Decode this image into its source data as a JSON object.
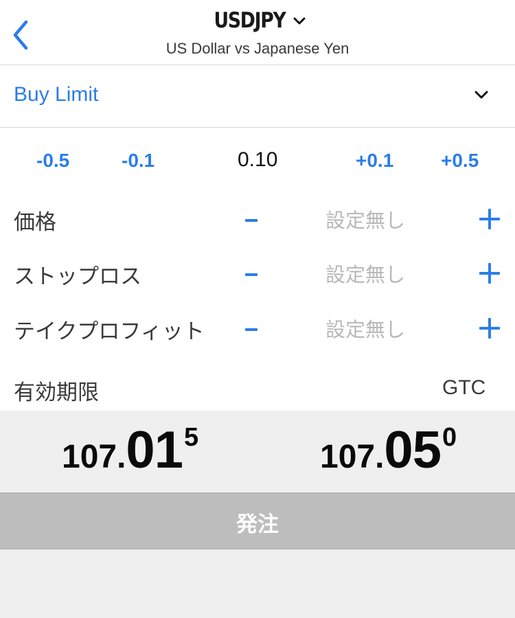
{
  "header": {
    "symbol": "USDJPY",
    "subtitle": "US Dollar vs Japanese Yen",
    "back_icon": "chevron-left-icon",
    "symbol_menu_icon": "chevron-down-icon"
  },
  "order_type": {
    "label": "Buy Limit",
    "icon": "chevron-down-icon"
  },
  "volume": {
    "minus_large": "-0.5",
    "minus_small": "-0.1",
    "value": "0.10",
    "plus_small": "+0.1",
    "plus_large": "+0.5"
  },
  "params": [
    {
      "label": "価格",
      "value": "設定無し"
    },
    {
      "label": "ストップロス",
      "value": "設定無し"
    },
    {
      "label": "テイクプロフィット",
      "value": "設定無し"
    }
  ],
  "expiry": {
    "label": "有効期限",
    "value": "GTC"
  },
  "quotes": {
    "bid": {
      "prefix": "107.",
      "big": "01",
      "sup": "5"
    },
    "ask": {
      "prefix": "107.",
      "big": "05",
      "sup": "0"
    }
  },
  "submit": {
    "label": "発注"
  },
  "colors": {
    "accent": "#2b7de9",
    "placeholder": "#b8b8b8",
    "quote_bg": "#efefef",
    "submit_bg": "#bdbdbd"
  }
}
